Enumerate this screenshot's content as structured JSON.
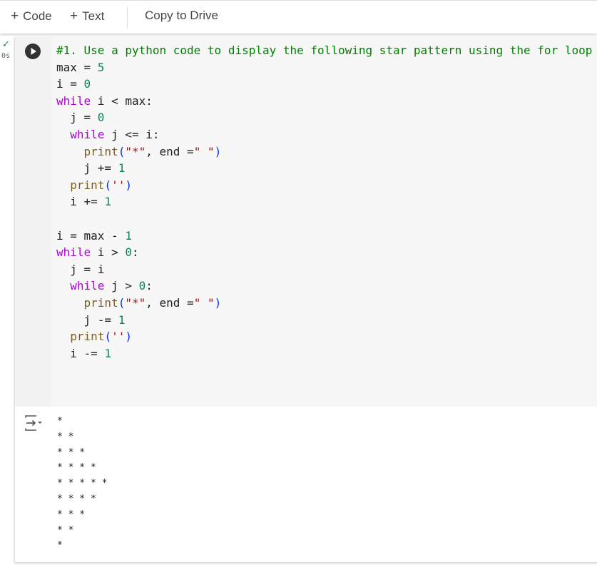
{
  "toolbar": {
    "add_code": "Code",
    "add_text": "Text",
    "copy_to_drive": "Copy to Drive"
  },
  "cell": {
    "status_icon": "check-icon",
    "exec_time": "0s",
    "code_lines": [
      [
        {
          "t": "#1. Use a python code to display the following star pattern using the for loop",
          "c": "cm"
        }
      ],
      [
        {
          "t": "max = ",
          "c": ""
        },
        {
          "t": "5",
          "c": "num"
        }
      ],
      [
        {
          "t": "i = ",
          "c": ""
        },
        {
          "t": "0",
          "c": "num"
        }
      ],
      [
        {
          "t": "while",
          "c": "kw"
        },
        {
          "t": " i < max:",
          "c": ""
        }
      ],
      [
        {
          "t": "  j = ",
          "c": ""
        },
        {
          "t": "0",
          "c": "num"
        }
      ],
      [
        {
          "t": "  ",
          "c": ""
        },
        {
          "t": "while",
          "c": "kw"
        },
        {
          "t": " j <= i:",
          "c": ""
        }
      ],
      [
        {
          "t": "    ",
          "c": ""
        },
        {
          "t": "print",
          "c": "fn"
        },
        {
          "t": "(",
          "c": "pn"
        },
        {
          "t": "\"*\"",
          "c": "str"
        },
        {
          "t": ", end =",
          "c": ""
        },
        {
          "t": "\" \"",
          "c": "str"
        },
        {
          "t": ")",
          "c": "pn"
        }
      ],
      [
        {
          "t": "    j += ",
          "c": ""
        },
        {
          "t": "1",
          "c": "num"
        }
      ],
      [
        {
          "t": "  ",
          "c": ""
        },
        {
          "t": "print",
          "c": "fn"
        },
        {
          "t": "(",
          "c": "pn"
        },
        {
          "t": "''",
          "c": "str"
        },
        {
          "t": ")",
          "c": "pn"
        }
      ],
      [
        {
          "t": "  i += ",
          "c": ""
        },
        {
          "t": "1",
          "c": "num"
        }
      ],
      [
        {
          "t": "",
          "c": ""
        }
      ],
      [
        {
          "t": "i = max - ",
          "c": ""
        },
        {
          "t": "1",
          "c": "num"
        }
      ],
      [
        {
          "t": "while",
          "c": "kw"
        },
        {
          "t": " i > ",
          "c": ""
        },
        {
          "t": "0",
          "c": "num"
        },
        {
          "t": ":",
          "c": ""
        }
      ],
      [
        {
          "t": "  j = i",
          "c": ""
        }
      ],
      [
        {
          "t": "  ",
          "c": ""
        },
        {
          "t": "while",
          "c": "kw"
        },
        {
          "t": " j > ",
          "c": ""
        },
        {
          "t": "0",
          "c": "num"
        },
        {
          "t": ":",
          "c": ""
        }
      ],
      [
        {
          "t": "    ",
          "c": ""
        },
        {
          "t": "print",
          "c": "fn"
        },
        {
          "t": "(",
          "c": "pn"
        },
        {
          "t": "\"*\"",
          "c": "str"
        },
        {
          "t": ", end =",
          "c": ""
        },
        {
          "t": "\" \"",
          "c": "str"
        },
        {
          "t": ")",
          "c": "pn"
        }
      ],
      [
        {
          "t": "    j -= ",
          "c": ""
        },
        {
          "t": "1",
          "c": "num"
        }
      ],
      [
        {
          "t": "  ",
          "c": ""
        },
        {
          "t": "print",
          "c": "fn"
        },
        {
          "t": "(",
          "c": "pn"
        },
        {
          "t": "''",
          "c": "str"
        },
        {
          "t": ")",
          "c": "pn"
        }
      ],
      [
        {
          "t": "  i -= ",
          "c": ""
        },
        {
          "t": "1",
          "c": "num"
        }
      ]
    ],
    "output_lines": [
      "*",
      "* *",
      "* * *",
      "* * * *",
      "* * * * *",
      "* * * *",
      "* * *",
      "* *",
      "*"
    ]
  },
  "colors": {
    "comment": "#008000",
    "keyword": "#af00db",
    "function": "#795e26",
    "number": "#098658",
    "string": "#a31515",
    "paren": "#0431fa"
  }
}
